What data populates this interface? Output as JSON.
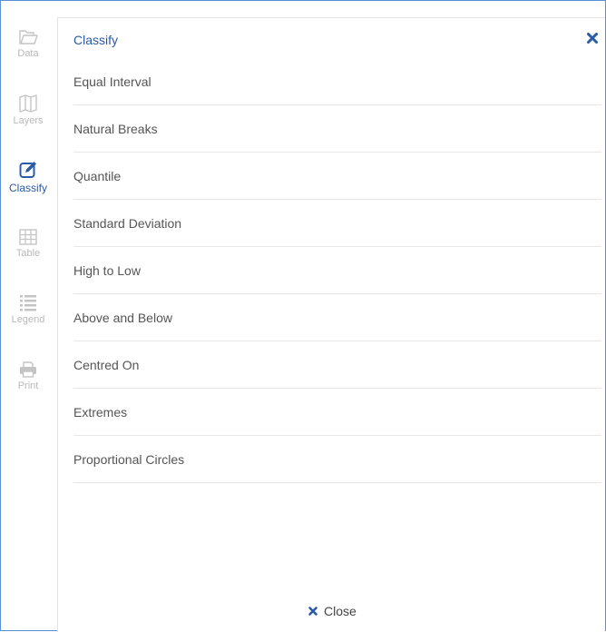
{
  "toolbar": {
    "items": [
      {
        "label": "Data",
        "icon": "folder-icon"
      },
      {
        "label": "Layers",
        "icon": "map-icon"
      },
      {
        "label": "Classify",
        "icon": "edit-icon"
      },
      {
        "label": "Table",
        "icon": "table-icon"
      },
      {
        "label": "Legend",
        "icon": "list-icon"
      },
      {
        "label": "Print",
        "icon": "print-icon"
      }
    ],
    "active": "Classify"
  },
  "panel": {
    "title": "Classify",
    "options": [
      "Equal Interval",
      "Natural Breaks",
      "Quantile",
      "Standard Deviation",
      "High to Low",
      "Above and Below",
      "Centred On",
      "Extremes",
      "Proportional Circles"
    ],
    "close_label": "Close"
  },
  "colors": {
    "accent": "#2b5aa8",
    "inactive_icon": "#c4c4c4",
    "border": "#5b8fd6",
    "divider": "#e6e6e6"
  }
}
